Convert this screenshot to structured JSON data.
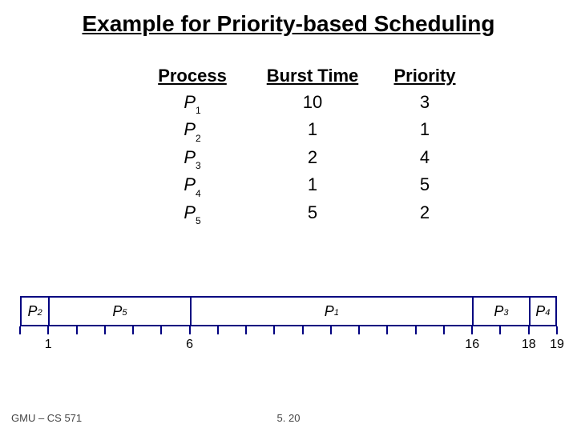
{
  "title": "Example for Priority-based Scheduling",
  "headers": {
    "process": "Process",
    "burst": "Burst Time",
    "priority": "Priority"
  },
  "procLetter": "P",
  "rows": [
    {
      "sub": "1",
      "burst": "10",
      "priority": "3"
    },
    {
      "sub": "2",
      "burst": "1",
      "priority": "1"
    },
    {
      "sub": "3",
      "burst": "2",
      "priority": "4"
    },
    {
      "sub": "4",
      "burst": "1",
      "priority": "5"
    },
    {
      "sub": "5",
      "burst": "5",
      "priority": "2"
    }
  ],
  "gantt": {
    "total": 19,
    "segments": [
      {
        "sub": "2",
        "start": 0,
        "end": 1
      },
      {
        "sub": "5",
        "start": 1,
        "end": 6
      },
      {
        "sub": "1",
        "start": 6,
        "end": 16
      },
      {
        "sub": "3",
        "start": 16,
        "end": 18
      },
      {
        "sub": "4",
        "start": 18,
        "end": 19
      }
    ],
    "timeLabels": [
      "1",
      "6",
      "16",
      "18",
      "19"
    ]
  },
  "footer": {
    "left": "GMU – CS 571",
    "center": "5. 20"
  },
  "chart_data": {
    "type": "table",
    "title": "Priority-based Scheduling",
    "columns": [
      "Process",
      "Burst Time",
      "Priority"
    ],
    "rows": [
      [
        "P1",
        10,
        3
      ],
      [
        "P2",
        1,
        1
      ],
      [
        "P3",
        2,
        4
      ],
      [
        "P4",
        1,
        5
      ],
      [
        "P5",
        5,
        2
      ]
    ],
    "gantt_order": [
      "P2",
      "P5",
      "P1",
      "P3",
      "P4"
    ],
    "gantt_times": [
      0,
      1,
      6,
      16,
      18,
      19
    ]
  }
}
